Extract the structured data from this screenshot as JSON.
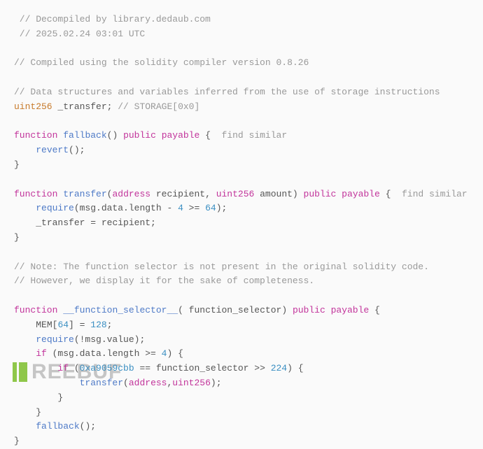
{
  "comments": {
    "decompiled": " // Decompiled by library.dedaub.com",
    "timestamp": " // 2025.02.24 03:01 UTC",
    "compiler": "// Compiled using the solidity compiler version 0.8.26",
    "datastruct": "// Data structures and variables inferred from the use of storage instructions",
    "storage_note": " // STORAGE[0x0]",
    "note1": "// Note: The function selector is not present in the original solidity code.",
    "note2": "// However, we display it for the sake of completeness.",
    "find_similar": "  find similar"
  },
  "decl": {
    "type_uint256": "uint256",
    "var_transfer": "_transfer",
    "semi": ";"
  },
  "fn_fallback": {
    "kw_function": "function",
    "name": "fallback",
    "parens": "()",
    "kw_public": "public",
    "kw_payable": "payable",
    "open": " {",
    "revert": "revert",
    "revert_call": "();",
    "close": "}"
  },
  "fn_transfer": {
    "kw_function": "function",
    "name": "transfer",
    "open_p": "(",
    "type_addr": "address",
    "param1": " recipient, ",
    "type_uint": "uint256",
    "param2": " amount",
    "close_p": ")",
    "kw_public": "public",
    "kw_payable": "payable",
    "open": " {",
    "require": "require",
    "req_args_a": "(msg.data.length - ",
    "req_n1": "4",
    "req_args_b": " >= ",
    "req_n2": "64",
    "req_args_c": ");",
    "assign_lhs": "_transfer",
    "assign": " = recipient;",
    "close": "}"
  },
  "fn_selector": {
    "kw_function": "function",
    "name": "__function_selector__",
    "open_p": "(",
    "param": " function_selector",
    "close_p": ")",
    "kw_public": "public",
    "kw_payable": "payable",
    "open": " {",
    "mem": "MEM",
    "mem_a": "[",
    "mem_n1": "64",
    "mem_b": "] = ",
    "mem_n2": "128",
    "mem_c": ";",
    "require": "require",
    "req_args": "(!msg.value);",
    "if1": "if",
    "if1_a": " (msg.data.length >= ",
    "if1_n": "4",
    "if1_b": ") {",
    "if2": "if",
    "if2_a": " (",
    "hex": "0xa9059cbb",
    "if2_b": " == function_selector >> ",
    "if2_n": "224",
    "if2_c": ") {",
    "call": "transfer",
    "call_a": "(",
    "call_t1": "address",
    "call_b": ",",
    "call_t2": "uint256",
    "call_c": ");",
    "close_inner": "}",
    "close_mid": "}",
    "fallback": "fallback",
    "fallback_call": "();",
    "close": "}"
  },
  "watermark": "REEBUF"
}
